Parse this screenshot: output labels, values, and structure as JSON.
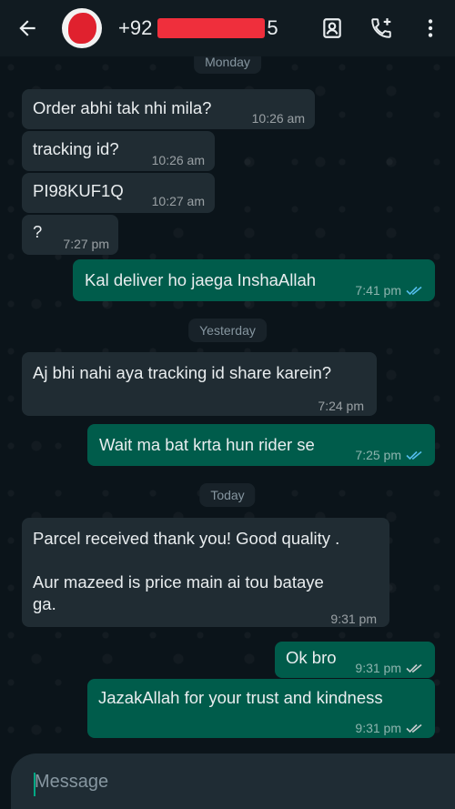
{
  "header": {
    "phone_prefix": "+92",
    "phone_suffix": "5",
    "icons": [
      "back-arrow-icon",
      "contact-card-icon",
      "add-call-icon",
      "more-vert-icon"
    ]
  },
  "colors": {
    "header_bg": "#111b21",
    "chat_bg": "#0b141a",
    "incoming_bubble": "#202c33",
    "outgoing_bubble": "#005c4b",
    "read_tick": "#53bdeb",
    "accent": "#00a884"
  },
  "date_chips": [
    "Monday",
    "Yesterday",
    "Today"
  ],
  "messages": [
    {
      "direction": "in",
      "text": "Order abhi tak nhi mila?",
      "time": "10:26 am"
    },
    {
      "direction": "in",
      "text": "tracking id?",
      "time": "10:26 am"
    },
    {
      "direction": "in",
      "text": "PI98KUF1Q",
      "time": "10:27 am"
    },
    {
      "direction": "in",
      "text": "?",
      "time": "7:27 pm"
    },
    {
      "direction": "out",
      "text": "Kal deliver ho jaega InshaAllah",
      "time": "7:41 pm",
      "status": "read"
    },
    {
      "direction": "in",
      "text": "Aj bhi nahi aya tracking id share karein?",
      "time": "7:24 pm"
    },
    {
      "direction": "out",
      "text": "Wait ma bat krta hun rider se",
      "time": "7:25 pm",
      "status": "read"
    },
    {
      "direction": "in",
      "text": "Parcel received thank you! Good quality .",
      "text2": "Aur mazeed is price main ai tou bataye",
      "text3": "ga.",
      "time": "9:31 pm"
    },
    {
      "direction": "out",
      "text": "Ok bro",
      "time": "9:31 pm",
      "status": "delivered"
    },
    {
      "direction": "out",
      "text": "JazakAllah for your trust and kindness",
      "time": "9:31 pm",
      "status": "delivered"
    }
  ],
  "composer": {
    "placeholder": "Message"
  }
}
